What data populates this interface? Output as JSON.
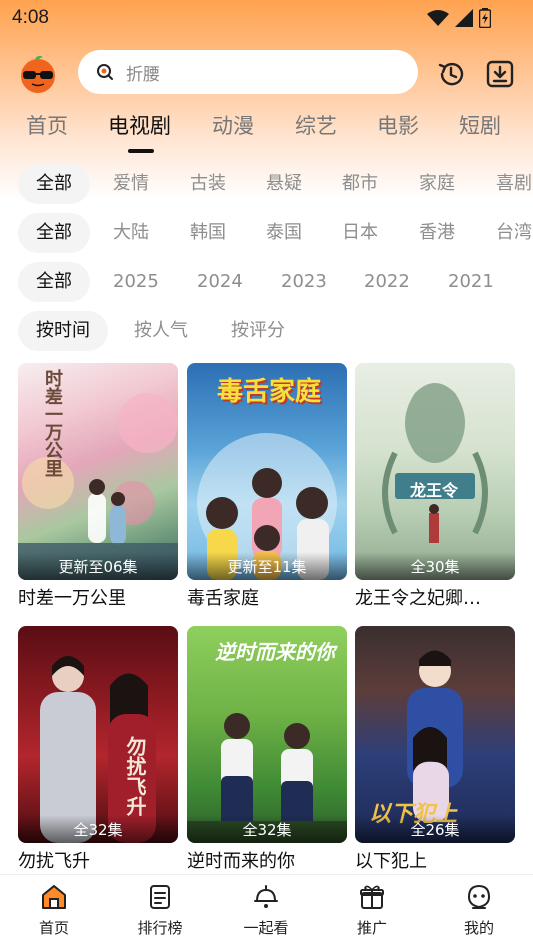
{
  "status_bar": {
    "time": "4:08"
  },
  "search": {
    "placeholder": "折腰"
  },
  "main_tabs": [
    "首页",
    "电视剧",
    "动漫",
    "综艺",
    "电影",
    "短剧"
  ],
  "active_main_tab": "电视剧",
  "filters": {
    "genre": [
      "全部",
      "爱情",
      "古装",
      "悬疑",
      "都市",
      "家庭",
      "喜剧"
    ],
    "region": [
      "全部",
      "大陆",
      "韩国",
      "泰国",
      "日本",
      "香港",
      "台湾"
    ],
    "year": [
      "全部",
      "2025",
      "2024",
      "2023",
      "2022",
      "2021"
    ],
    "sort": [
      "按时间",
      "按人气",
      "按评分"
    ]
  },
  "shows": [
    {
      "title": "时差一万公里",
      "badge": "更新至06集",
      "art_text": "时差一万公里"
    },
    {
      "title": "毒舌家庭",
      "badge": "更新至11集",
      "art_text": "毒舌家庭"
    },
    {
      "title": "龙王令之妃卿…",
      "badge": "全30集",
      "art_text": "龙王令"
    },
    {
      "title": "勿扰飞升",
      "badge": "全32集",
      "art_text": "勿扰飞升"
    },
    {
      "title": "逆时而来的你",
      "badge": "全32集",
      "art_text": "逆时而来的你"
    },
    {
      "title": "以下犯上",
      "badge": "全26集",
      "art_text": "以下犯上"
    }
  ],
  "bottom_nav": [
    "首页",
    "排行榜",
    "一起看",
    "推广",
    "我的"
  ],
  "colors": {
    "accent": "#ff8a2a",
    "header_top": "#ffa24f"
  }
}
